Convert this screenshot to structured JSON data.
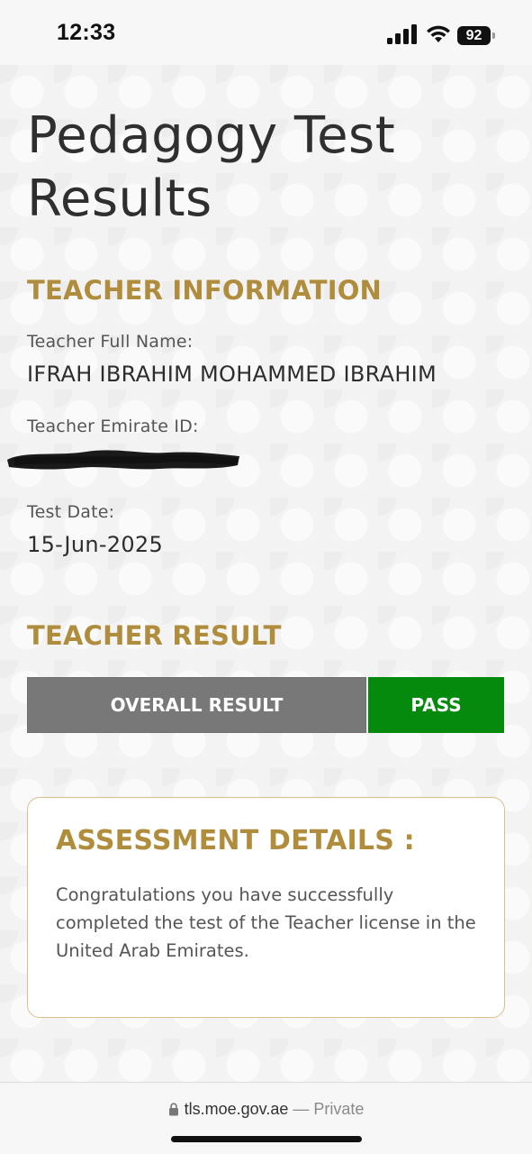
{
  "status_bar": {
    "time": "12:33",
    "battery": "92",
    "signal_icon": "cellular-signal-icon",
    "wifi_icon": "wifi-icon"
  },
  "page": {
    "title": "Pedagogy Test Results"
  },
  "teacher_information": {
    "heading": "TEACHER INFORMATION",
    "full_name_label": "Teacher Full Name:",
    "full_name_value": "IFRAH IBRAHIM MOHAMMED IBRAHIM",
    "emirate_id_label": "Teacher Emirate ID:",
    "test_date_label": "Test Date:",
    "test_date_value": "15-Jun-2025"
  },
  "teacher_result": {
    "heading": "TEACHER RESULT",
    "overall_label": "OVERALL RESULT",
    "overall_value": "PASS"
  },
  "assessment": {
    "heading": "ASSESSMENT DETAILS :",
    "text": "Congratulations you have successfully completed the test of the Teacher license in the United Arab Emirates."
  },
  "browser": {
    "domain": "tls.moe.gov.ae",
    "mode": "— Private"
  },
  "colors": {
    "accent_gold": "#b08d3c",
    "pass_green": "#068a0e",
    "result_gray": "#787878"
  }
}
